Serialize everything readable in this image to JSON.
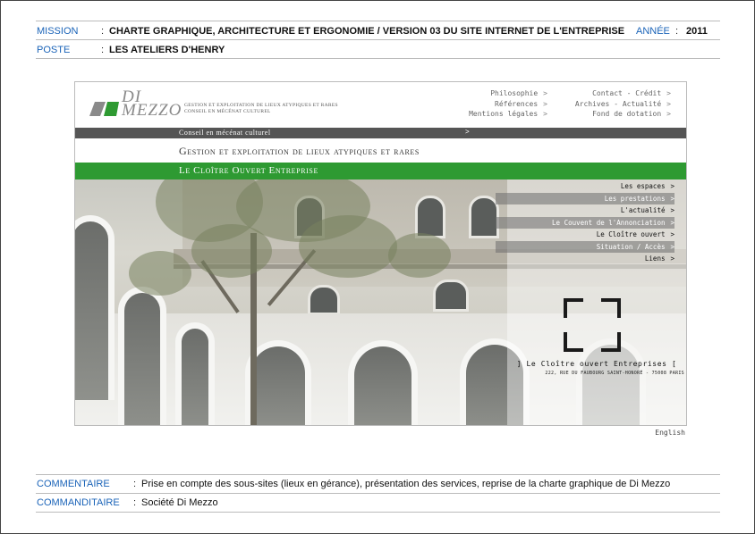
{
  "header": {
    "mission_label": "MISSION",
    "mission_value": "CHARTE GRAPHIQUE, ARCHITECTURE ET ERGONOMIE / VERSION 03 DU SITE INTERNET DE L'ENTREPRISE",
    "year_label": "ANNÉE",
    "year_value": "2011",
    "poste_label": "POSTE",
    "poste_value": "LES ATELIERS D'HENRY",
    "separator": ":"
  },
  "site": {
    "logo_name_line1": "DI",
    "logo_name_line2": "MEZZO",
    "logo_tagline_line1": "Gestion et exploitation de lieux atypiques et rares",
    "logo_tagline_line2": "Conseil en mécénat culturel",
    "topnav_col1": [
      "Philosophie",
      "Références",
      "Mentions légales"
    ],
    "topnav_col2": [
      "Contact - Crédit",
      "Archives - Actualité",
      "Fond de dotation"
    ],
    "chevron": ">",
    "bar_grey_text": "Conseil en mécénat culturel",
    "bar_white_text": "Gestion et exploitation de lieux atypiques et rares",
    "bar_green_text": "Le Cloître Ouvert Entreprise",
    "menu": [
      {
        "label": "Les espaces",
        "dark": false
      },
      {
        "label": "Les prestations",
        "dark": true
      },
      {
        "label": "L'actualité",
        "dark": false
      },
      {
        "label": "Le Couvent de l'Annonciation",
        "dark": true
      },
      {
        "label": "Le Cloître ouvert",
        "dark": false
      },
      {
        "label": "Situation / Accès",
        "dark": true
      },
      {
        "label": "Liens",
        "dark": false
      }
    ],
    "cloitre_title": "] Le Cloître ouvert Entreprises [",
    "cloitre_address": "222, rue du Faubourg Saint-Honoré - 75008 PARIS",
    "english_link": "English"
  },
  "footer": {
    "comment_label": "COMMENTAIRE",
    "comment_value": "Prise en compte des sous-sites (lieux en gérance), présentation des services, reprise de la charte graphique de Di Mezzo",
    "client_label": "COMMANDITAIRE",
    "client_value": "Société Di Mezzo"
  },
  "colors": {
    "label_blue": "#1a63b8",
    "brand_green": "#2e9a32",
    "bar_grey": "#555555"
  }
}
